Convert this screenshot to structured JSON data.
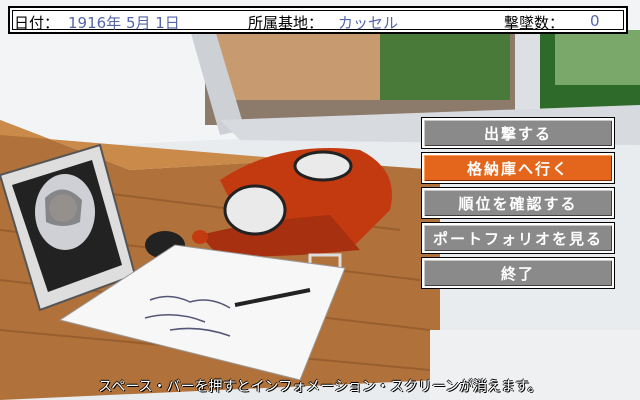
{
  "header": {
    "date_label": "日付：",
    "date_value": "1916年 5月 1日",
    "base_label": "所属基地：",
    "base_value": "カッセル",
    "kills_label": "撃墜数：",
    "kills_value": "0"
  },
  "menu": {
    "items": [
      {
        "label": "出撃する"
      },
      {
        "label": "格納庫へ行く"
      },
      {
        "label": "順位を確認する"
      },
      {
        "label": "ポートフォリオを見る"
      },
      {
        "label": "終了"
      }
    ],
    "selected_index": 1
  },
  "status_text": "スペース・バーを押すとインフォメーション・スクリーンが消えます。",
  "colors": {
    "menu_button": "#8a8a8a",
    "menu_selected": "#e4661c",
    "value_text": "#5566aa"
  }
}
